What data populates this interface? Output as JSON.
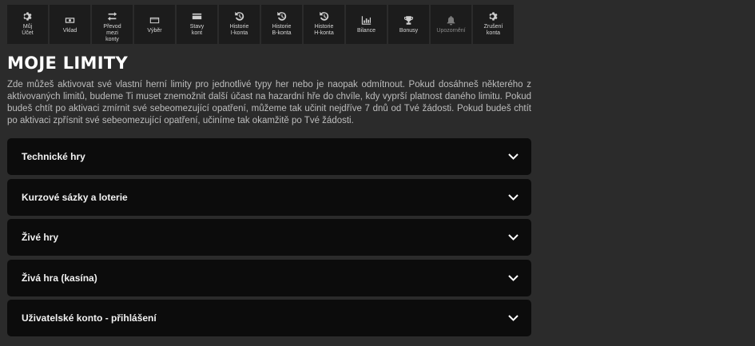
{
  "nav": [
    {
      "label": "Můj\nÚčet",
      "icon": "gear-icon",
      "disabled": false
    },
    {
      "label": "Vklad",
      "icon": "cash-icon",
      "disabled": false
    },
    {
      "label": "Převod\nmezi\nkonty",
      "icon": "transfer-icon",
      "disabled": false
    },
    {
      "label": "Výběr",
      "icon": "card-icon",
      "disabled": false
    },
    {
      "label": "Stavy\nkont",
      "icon": "wallet-card-icon",
      "disabled": false
    },
    {
      "label": "Historie\nI-konta",
      "icon": "history-icon",
      "disabled": false
    },
    {
      "label": "Historie\nB-konta",
      "icon": "history-icon",
      "disabled": false
    },
    {
      "label": "Historie\nH-konta",
      "icon": "history-icon",
      "disabled": false
    },
    {
      "label": "Bilance",
      "icon": "bar-chart-icon",
      "disabled": false
    },
    {
      "label": "Bonusy",
      "icon": "trophy-icon",
      "disabled": false
    },
    {
      "label": "Upozornění",
      "icon": "bell-icon",
      "disabled": true
    },
    {
      "label": "Zrušení\nkonta",
      "icon": "gear-icon",
      "disabled": false
    }
  ],
  "page": {
    "title": "MOJE LIMITY",
    "intro": "Zde můžeš aktivovat své vlastní herní limity pro jednotlivé typy her nebo je naopak odmítnout. Pokud dosáhneš některého z aktivovaných limitů, budeme Ti muset znemožnit další účast na hazardní hře do chvíle, kdy vyprší platnost daného limitu. Pokud budeš chtít po aktivaci zmírnit své sebeomezující opatření, můžeme tak učinit nejdříve 7 dnů od Tvé žádosti. Pokud budeš chtít po aktivaci zpřísnit své sebeomezující opatření, učiníme tak okamžitě po Tvé žádosti."
  },
  "accordion": [
    {
      "label": "Technické hry"
    },
    {
      "label": "Kurzové sázky a loterie"
    },
    {
      "label": "Živé hry"
    },
    {
      "label": "Živá hra (kasína)"
    },
    {
      "label": "Uživatelské konto - přihlášení"
    }
  ],
  "colors": {
    "background": "#2b2b2b",
    "nav_tile": "#1c1c1c",
    "accordion_row": "#0c0c0c",
    "text_muted": "#bdbdbd"
  }
}
